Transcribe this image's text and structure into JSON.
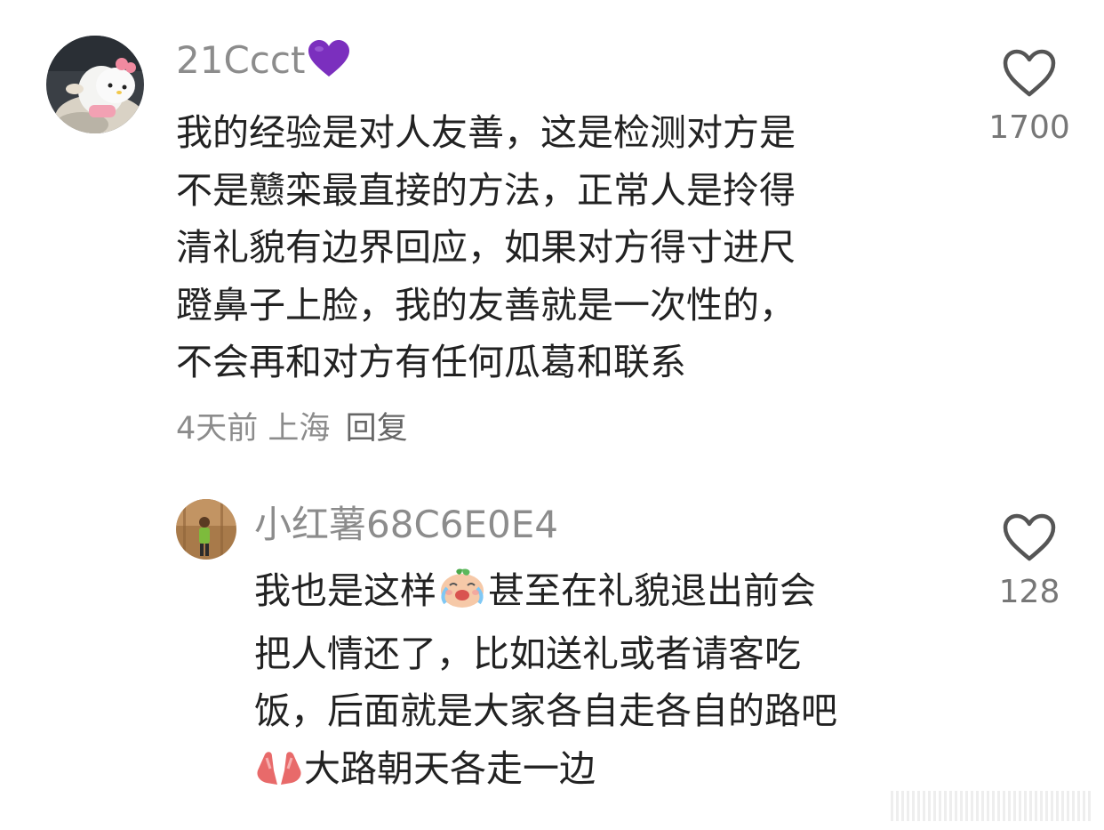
{
  "comments": [
    {
      "username": "21Ccct",
      "username_emoji": "purple-heart-icon",
      "lines": [
        "我的经验是对人友善，这是检测对方是",
        "不是戆栾最直接的方法，正常人是拎得",
        "清礼貌有边界回应，如果对方得寸进尺",
        "蹬鼻子上脸，我的友善就是一次性的，",
        "不会再和对方有任何瓜葛和联系"
      ],
      "time": "4天前",
      "location": "上海",
      "reply_label": "回复",
      "like_count": "1700"
    },
    {
      "username": "小红薯68C6E0E4",
      "lines": {
        "l1_before": "我也是这样",
        "l1_emoji": "crying-face-icon",
        "l1_after": "甚至在礼貌退出前会",
        "l2": "把人情还了，比如送礼或者请客吃",
        "l3": "饭，后面就是大家各自走各自的路吧",
        "l4_emoji": "praying-hands-icon",
        "l4_after": "大路朝天各走一边"
      },
      "like_count": "128"
    }
  ],
  "colors": {
    "text": "#222222",
    "secondary": "#8c8c8c",
    "heart_outline": "#555555",
    "purple_heart": "#7b2fbe"
  }
}
